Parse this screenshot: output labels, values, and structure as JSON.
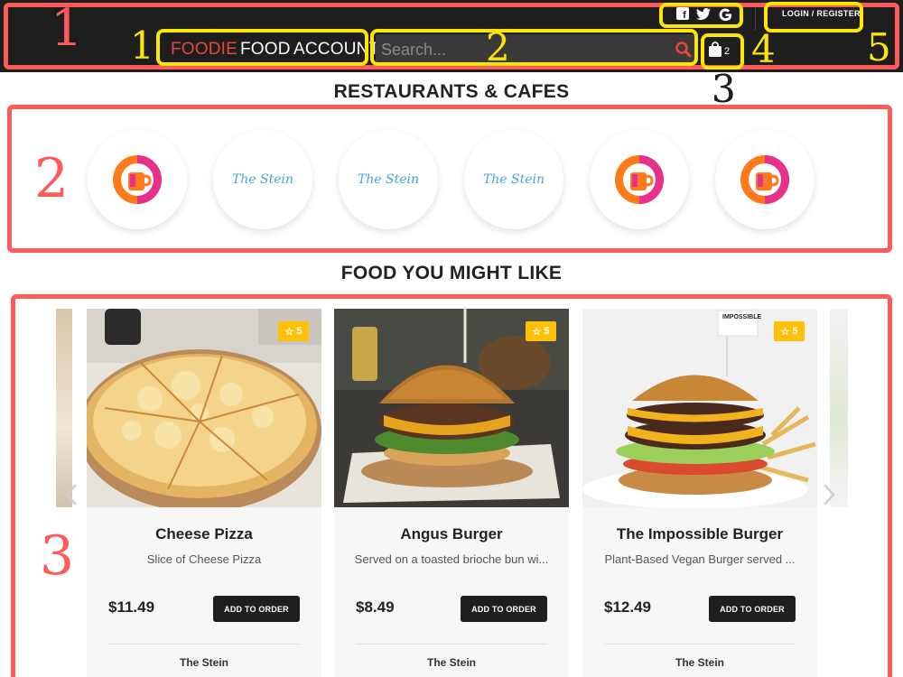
{
  "header": {
    "nav": [
      {
        "label": "FOODIE",
        "accent": true
      },
      {
        "label": "FOOD",
        "accent": false
      },
      {
        "label": "ACCOUNT",
        "accent": false
      }
    ],
    "search": {
      "placeholder": "Search...",
      "value": ""
    },
    "cart": {
      "count": "2"
    },
    "social": [
      "facebook-icon",
      "twitter-icon",
      "google-icon"
    ],
    "login_label": "LOGIN / REGISTER"
  },
  "restaurants": {
    "title": "RESTAURANTS & CAFES",
    "items": [
      {
        "logo": "dunkin-donuts-logo",
        "text": ""
      },
      {
        "logo": "the-stein-logo",
        "text": "The Stein"
      },
      {
        "logo": "the-stein-logo",
        "text": "The Stein"
      },
      {
        "logo": "the-stein-logo",
        "text": "The Stein"
      },
      {
        "logo": "dunkin-donuts-logo",
        "text": ""
      },
      {
        "logo": "dunkin-donuts-logo",
        "text": ""
      }
    ]
  },
  "food": {
    "title": "FOOD YOU MIGHT LIKE",
    "items": [
      {
        "name": "Cheese Pizza",
        "description": "Slice of Cheese Pizza",
        "price": "$11.49",
        "button": "ADD TO ORDER",
        "restaurant": "The Stein",
        "rating": "5"
      },
      {
        "name": "Angus Burger",
        "description": "Served on a toasted brioche bun wi...",
        "price": "$8.49",
        "button": "ADD TO ORDER",
        "restaurant": "The Stein",
        "rating": "5"
      },
      {
        "name": "The Impossible Burger",
        "description": "Plant-Based Vegan Burger served ...",
        "price": "$12.49",
        "button": "ADD TO ORDER",
        "restaurant": "The Stein",
        "rating": "5"
      }
    ]
  },
  "annotations": {
    "red": [
      "1",
      "2",
      "3"
    ],
    "yellow": [
      "1",
      "2",
      "3",
      "4",
      "5"
    ]
  },
  "colors": {
    "header_bg": "#1e1e1e",
    "accent": "#e8463d",
    "annotation_red": "#ff5a5a",
    "annotation_yellow": "#ffe600",
    "badge": "#ffc107",
    "stein_blue": "#4aa3d8"
  }
}
